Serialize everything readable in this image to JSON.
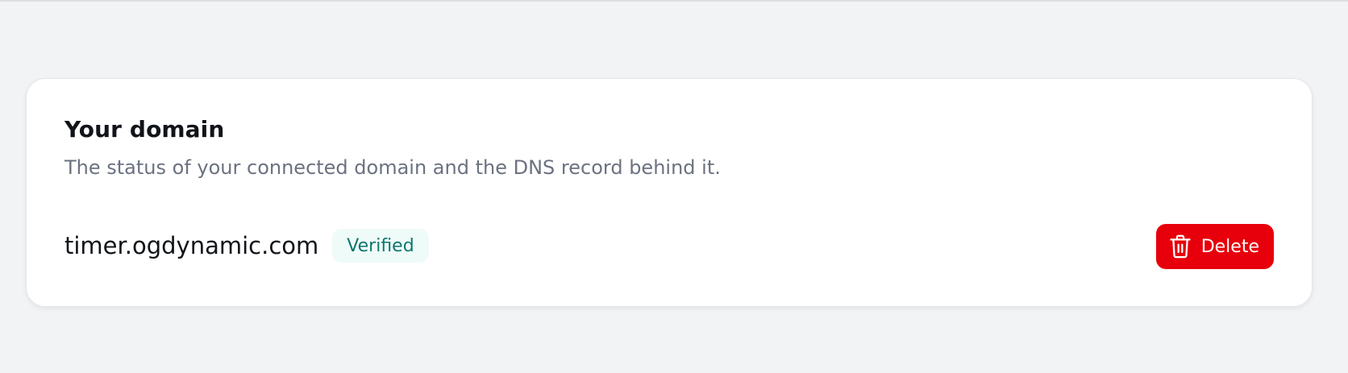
{
  "domain_card": {
    "title": "Your domain",
    "description": "The status of your connected domain and the DNS record behind it.",
    "domain": "timer.ogdynamic.com",
    "status": "Verified",
    "delete_label": "Delete",
    "delete_icon": "trash-icon"
  },
  "colors": {
    "page_background": "#f2f3f5",
    "card_background": "#ffffff",
    "badge_background": "#eefbf9",
    "badge_text": "#0f766e",
    "danger": "#e7000b",
    "muted_text": "#6b7280"
  }
}
